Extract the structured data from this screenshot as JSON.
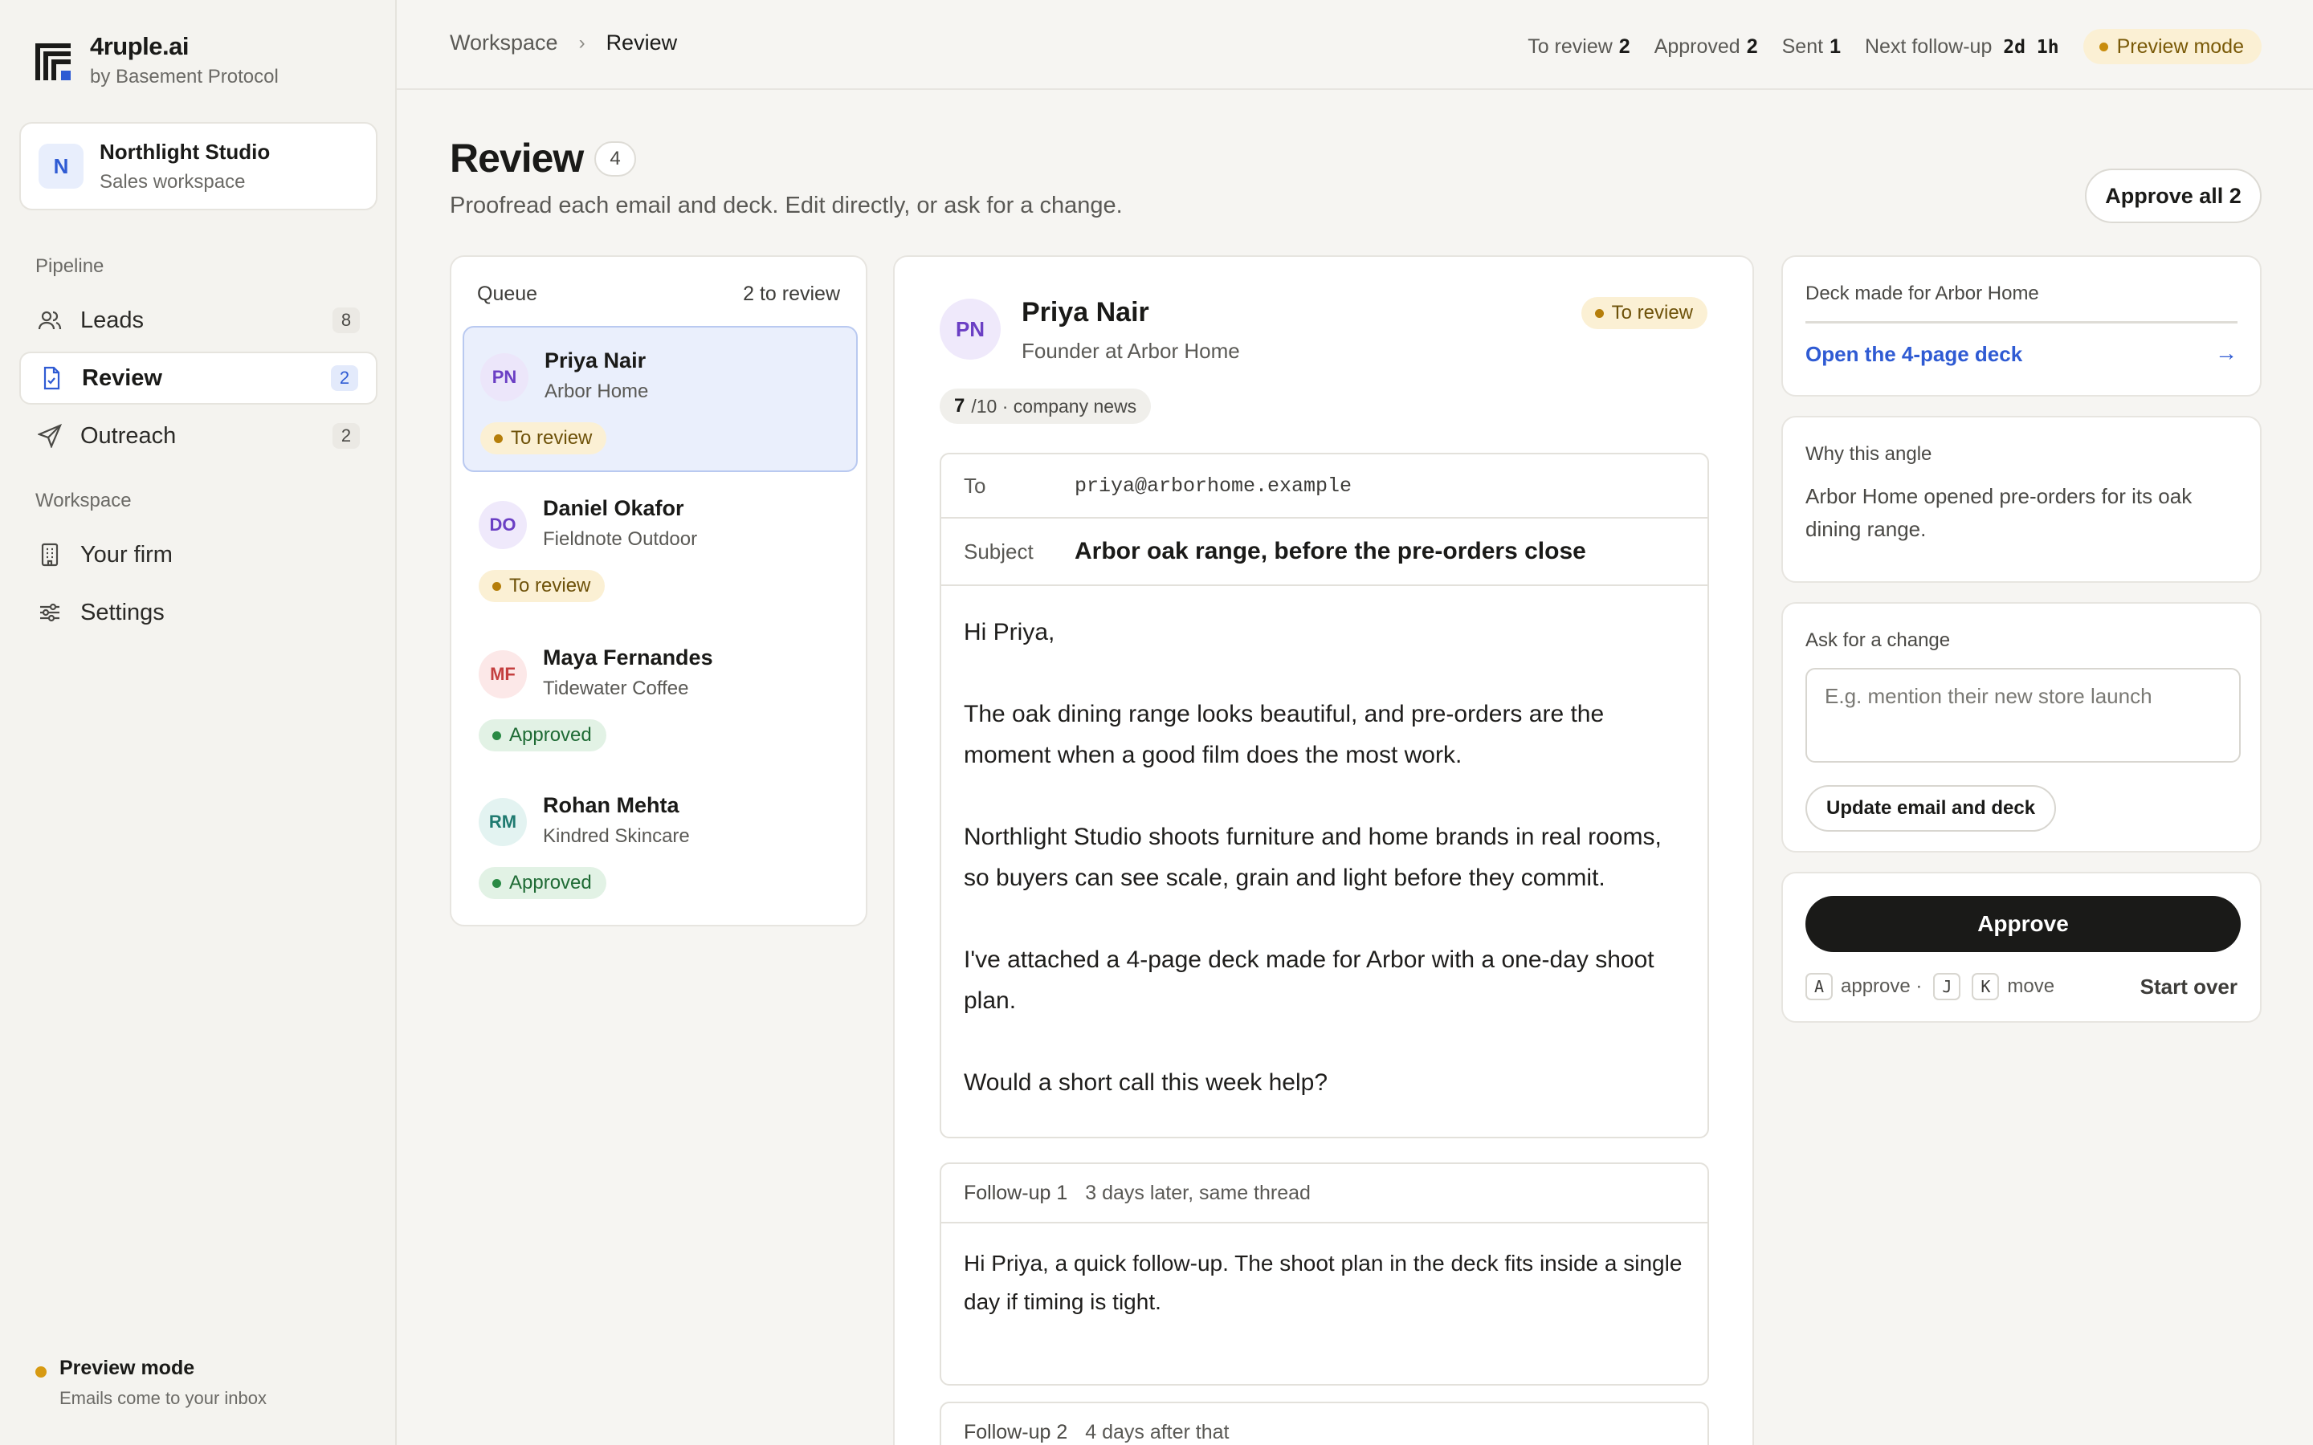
{
  "brand": {
    "name": "4ruple.ai",
    "sub": "by Basement Protocol"
  },
  "workspace": {
    "initial": "N",
    "name": "Northlight Studio",
    "sub": "Sales workspace"
  },
  "sidebar": {
    "pipeline_label": "Pipeline",
    "workspace_label": "Workspace",
    "items": [
      {
        "label": "Leads",
        "count": "8",
        "icon": "users-icon"
      },
      {
        "label": "Review",
        "count": "2",
        "icon": "document-check-icon"
      },
      {
        "label": "Outreach",
        "count": "2",
        "icon": "send-icon"
      },
      {
        "label": "Your firm",
        "icon": "building-icon"
      },
      {
        "label": "Settings",
        "icon": "sliders-icon"
      }
    ],
    "footer": {
      "title": "Preview mode",
      "sub": "Emails come to your inbox"
    }
  },
  "breadcrumb": {
    "parent": "Workspace",
    "current": "Review"
  },
  "stats": {
    "to_review_label": "To review",
    "to_review": "2",
    "approved_label": "Approved",
    "approved": "2",
    "sent_label": "Sent",
    "sent": "1",
    "followup_label": "Next follow-up",
    "followup_days": "2d",
    "followup_hours": "1h",
    "mode": "Preview mode"
  },
  "page": {
    "title": "Review",
    "count": "4",
    "subtitle": "Proofread each email and deck. Edit directly, or ask for a change.",
    "approve_all": "Approve all 2"
  },
  "queue": {
    "title": "Queue",
    "summary": "2 to review",
    "items": [
      {
        "initials": "PN",
        "name": "Priya Nair",
        "company": "Arbor Home",
        "status": "To review"
      },
      {
        "initials": "DO",
        "name": "Daniel Okafor",
        "company": "Fieldnote Outdoor",
        "status": "To review"
      },
      {
        "initials": "MF",
        "name": "Maya Fernandes",
        "company": "Tidewater Coffee",
        "status": "Approved"
      },
      {
        "initials": "RM",
        "name": "Rohan Mehta",
        "company": "Kindred Skincare",
        "status": "Approved"
      }
    ]
  },
  "email": {
    "initials": "PN",
    "name": "Priya Nair",
    "role": "Founder at Arbor Home",
    "status": "To review",
    "score": "7",
    "score_suffix": "/10 · company news",
    "to_label": "To",
    "to": "priya@arborhome.example",
    "subject_label": "Subject",
    "subject": "Arbor oak range, before the pre-orders close",
    "body": [
      "Hi Priya,",
      "The oak dining range looks beautiful, and pre-orders are the moment when a good film does the most work.",
      "Northlight Studio shoots furniture and home brands in real rooms, so buyers can see scale, grain and light before they commit.",
      "I've attached a 4-page deck made for Arbor with a one-day shoot plan.",
      "Would a short call this week help?"
    ],
    "followups": [
      {
        "label": "Follow-up 1",
        "when": "3 days later, same thread",
        "body": "Hi Priya, a quick follow-up. The shoot plan in the deck fits inside a single day if timing is tight."
      },
      {
        "label": "Follow-up 2",
        "when": "4 days after that",
        "body": ""
      }
    ]
  },
  "deck": {
    "label": "Deck made for Arbor Home",
    "link": "Open the 4-page deck"
  },
  "why": {
    "label": "Why this angle",
    "text": "Arbor Home opened pre-orders for its oak dining range."
  },
  "change": {
    "label": "Ask for a change",
    "placeholder": "E.g. mention their new store launch",
    "button": "Update email and deck"
  },
  "actions": {
    "approve": "Approve",
    "key_approve": "A",
    "approve_text": "approve ·",
    "key_next": "J",
    "key_prev": "K",
    "move_text": "move",
    "start_over": "Start over"
  },
  "colors": {
    "accent": "#2f5bd3",
    "pending": "#b57e0a",
    "approved": "#2a8a45",
    "primary": "#1a1a18"
  }
}
